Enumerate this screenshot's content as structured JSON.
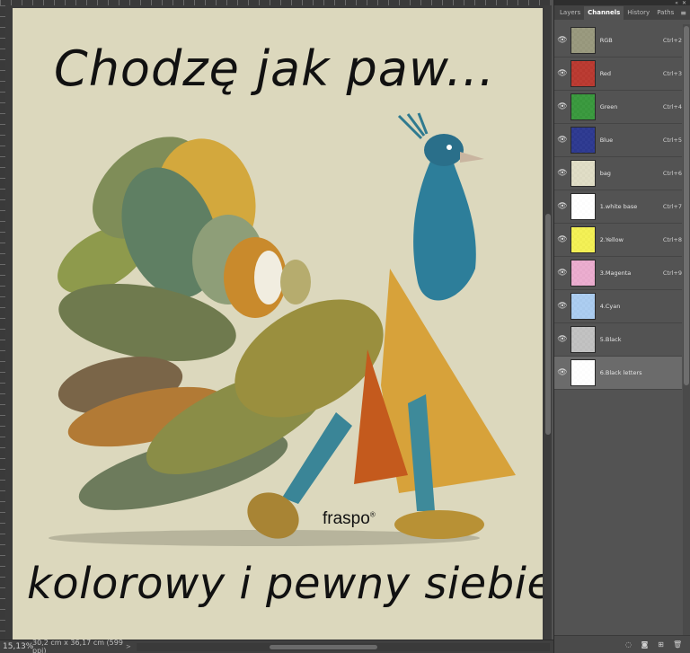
{
  "document": {
    "headline": "Chodzę  jak  paw...",
    "tagline": "kolorowy i pewny siebie",
    "brand": "fraspo",
    "brand_mark": "®",
    "background_color": "#dcd8bd"
  },
  "statusbar": {
    "zoom": "15,13%",
    "doc_info": "30,2 cm x 36,17 cm (599 ppi)",
    "arrow": ">"
  },
  "panel": {
    "tabs": [
      {
        "label": "Layers",
        "active": false
      },
      {
        "label": "Channels",
        "active": true
      },
      {
        "label": "History",
        "active": false
      },
      {
        "label": "Paths",
        "active": false
      }
    ],
    "menu_icon": "≡",
    "channels": [
      {
        "name": "RGB",
        "shortcut": "Ctrl+2",
        "visible": true,
        "color": "#8a8a6a",
        "selected": false
      },
      {
        "name": "Red",
        "shortcut": "Ctrl+3",
        "visible": true,
        "color": "#b01b10",
        "selected": false
      },
      {
        "name": "Green",
        "shortcut": "Ctrl+4",
        "visible": true,
        "color": "#1b8a20",
        "selected": false
      },
      {
        "name": "Blue",
        "shortcut": "Ctrl+5",
        "visible": true,
        "color": "#0d1b80",
        "selected": false
      },
      {
        "name": "bag",
        "shortcut": "Ctrl+6",
        "visible": true,
        "color": "#dcd8bd",
        "selected": false
      },
      {
        "name": "1.white base",
        "shortcut": "Ctrl+7",
        "visible": true,
        "color": "#ffffff",
        "selected": false
      },
      {
        "name": "2.Yellow",
        "shortcut": "Ctrl+8",
        "visible": true,
        "color": "#f2ee3a",
        "selected": false
      },
      {
        "name": "3.Magenta",
        "shortcut": "Ctrl+9",
        "visible": true,
        "color": "#e9a0c8",
        "selected": false
      },
      {
        "name": "4.Cyan",
        "shortcut": "",
        "visible": true,
        "color": "#9fc6ee",
        "selected": false
      },
      {
        "name": "5.Black",
        "shortcut": "",
        "visible": true,
        "color": "#b9b9b9",
        "selected": false
      },
      {
        "name": "6.Black letters",
        "shortcut": "",
        "visible": true,
        "color": "#ffffff",
        "selected": true
      }
    ],
    "footer_icons": [
      "dotted-circle-icon",
      "mask-icon",
      "new-channel-icon",
      "trash-icon"
    ]
  },
  "colors": {
    "panel_bg": "#535353",
    "workspace_bg": "#3b3b3b",
    "selected_row": "#6b6b6b"
  }
}
